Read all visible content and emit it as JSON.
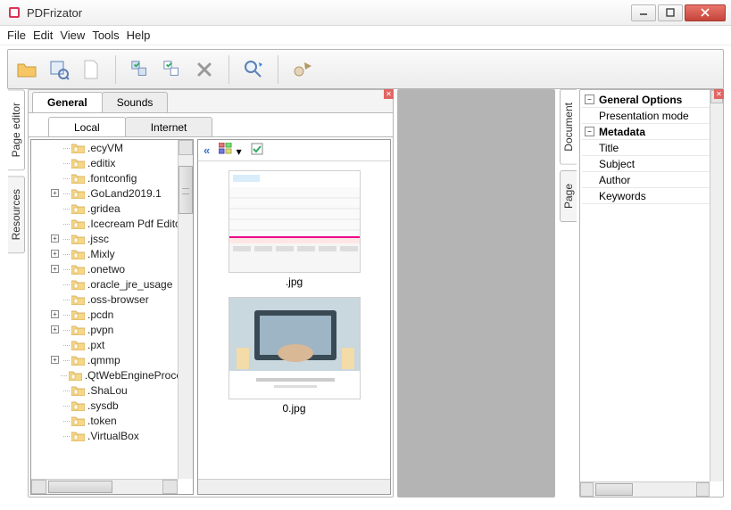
{
  "window": {
    "title": "PDFrizator"
  },
  "menu": {
    "file": "File",
    "edit": "Edit",
    "view": "View",
    "tools": "Tools",
    "help": "Help"
  },
  "sidetabs": {
    "page_editor": "Page editor",
    "resources": "Resources",
    "document": "Document",
    "page": "Page"
  },
  "top_tabs": {
    "general": "General",
    "sounds": "Sounds"
  },
  "sub_tabs": {
    "local": "Local",
    "internet": "Internet"
  },
  "tree": {
    "items": [
      {
        "expand": null,
        "label": ".ecyVM"
      },
      {
        "expand": null,
        "label": ".editix"
      },
      {
        "expand": null,
        "label": ".fontconfig"
      },
      {
        "expand": "+",
        "label": ".GoLand2019.1"
      },
      {
        "expand": null,
        "label": ".gridea"
      },
      {
        "expand": null,
        "label": ".Icecream Pdf Editor"
      },
      {
        "expand": "+",
        "label": ".jssc"
      },
      {
        "expand": "+",
        "label": ".Mixly"
      },
      {
        "expand": "+",
        "label": ".onetwo"
      },
      {
        "expand": null,
        "label": ".oracle_jre_usage"
      },
      {
        "expand": null,
        "label": ".oss-browser"
      },
      {
        "expand": "+",
        "label": ".pcdn"
      },
      {
        "expand": "+",
        "label": ".pvpn"
      },
      {
        "expand": null,
        "label": ".pxt"
      },
      {
        "expand": "+",
        "label": ".qmmp"
      },
      {
        "expand": null,
        "label": ".QtWebEngineProcess"
      },
      {
        "expand": null,
        "label": ".ShaLou"
      },
      {
        "expand": null,
        "label": ".sysdb"
      },
      {
        "expand": null,
        "label": ".token"
      },
      {
        "expand": null,
        "label": ".VirtualBox"
      }
    ]
  },
  "thumbs": {
    "items": [
      {
        "caption": ".jpg"
      },
      {
        "caption": "0.jpg"
      }
    ]
  },
  "props": {
    "general_options": "General Options",
    "presentation_mode": "Presentation mode",
    "metadata": "Metadata",
    "title": "Title",
    "subject": "Subject",
    "author": "Author",
    "keywords": "Keywords"
  }
}
